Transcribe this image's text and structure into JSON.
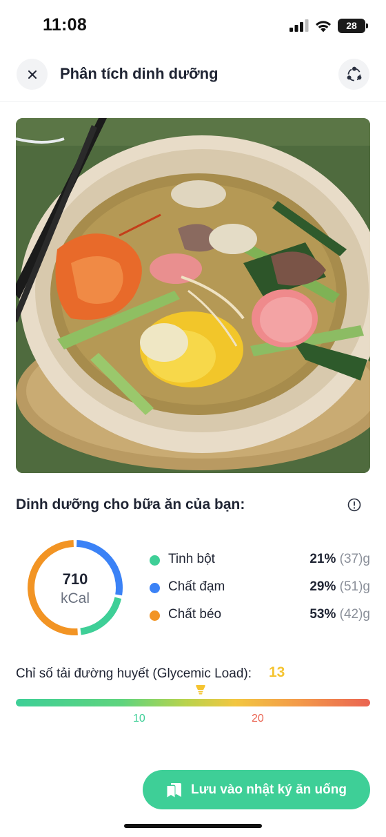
{
  "status_bar": {
    "time": "11:08",
    "battery": "28"
  },
  "header": {
    "title": "Phân tích dinh dưỡng"
  },
  "nutrition": {
    "section_title": "Dinh dưỡng cho bữa ăn của bạn:",
    "calories": {
      "value": "710",
      "unit": "kCal"
    },
    "macros": [
      {
        "label": "Tinh bột",
        "percent": "21%",
        "grams": "(37)g",
        "color": "#3ecf97"
      },
      {
        "label": "Chất đạm",
        "percent": "29%",
        "grams": "(51)g",
        "color": "#3b82f6"
      },
      {
        "label": "Chất béo",
        "percent": "53%",
        "grams": "(42)g",
        "color": "#f29424"
      }
    ]
  },
  "glycemic_load": {
    "label": "Chỉ số tải đường huyết (Glycemic Load):",
    "value": "13",
    "value_numeric": 13,
    "ticks": [
      {
        "label": "10",
        "color": "#3ecf97"
      },
      {
        "label": "20",
        "color": "#ea6452"
      }
    ]
  },
  "actions": {
    "save_label": "Lưu vào nhật ký ăn uống"
  },
  "colors": {
    "accent": "#3ecf97",
    "gl_value": "#f5c431"
  },
  "icons": {
    "close": "close-icon",
    "share": "share-icon",
    "info": "info-icon",
    "save": "bookmark-icon",
    "gl_marker": "lightbulb-icon"
  }
}
